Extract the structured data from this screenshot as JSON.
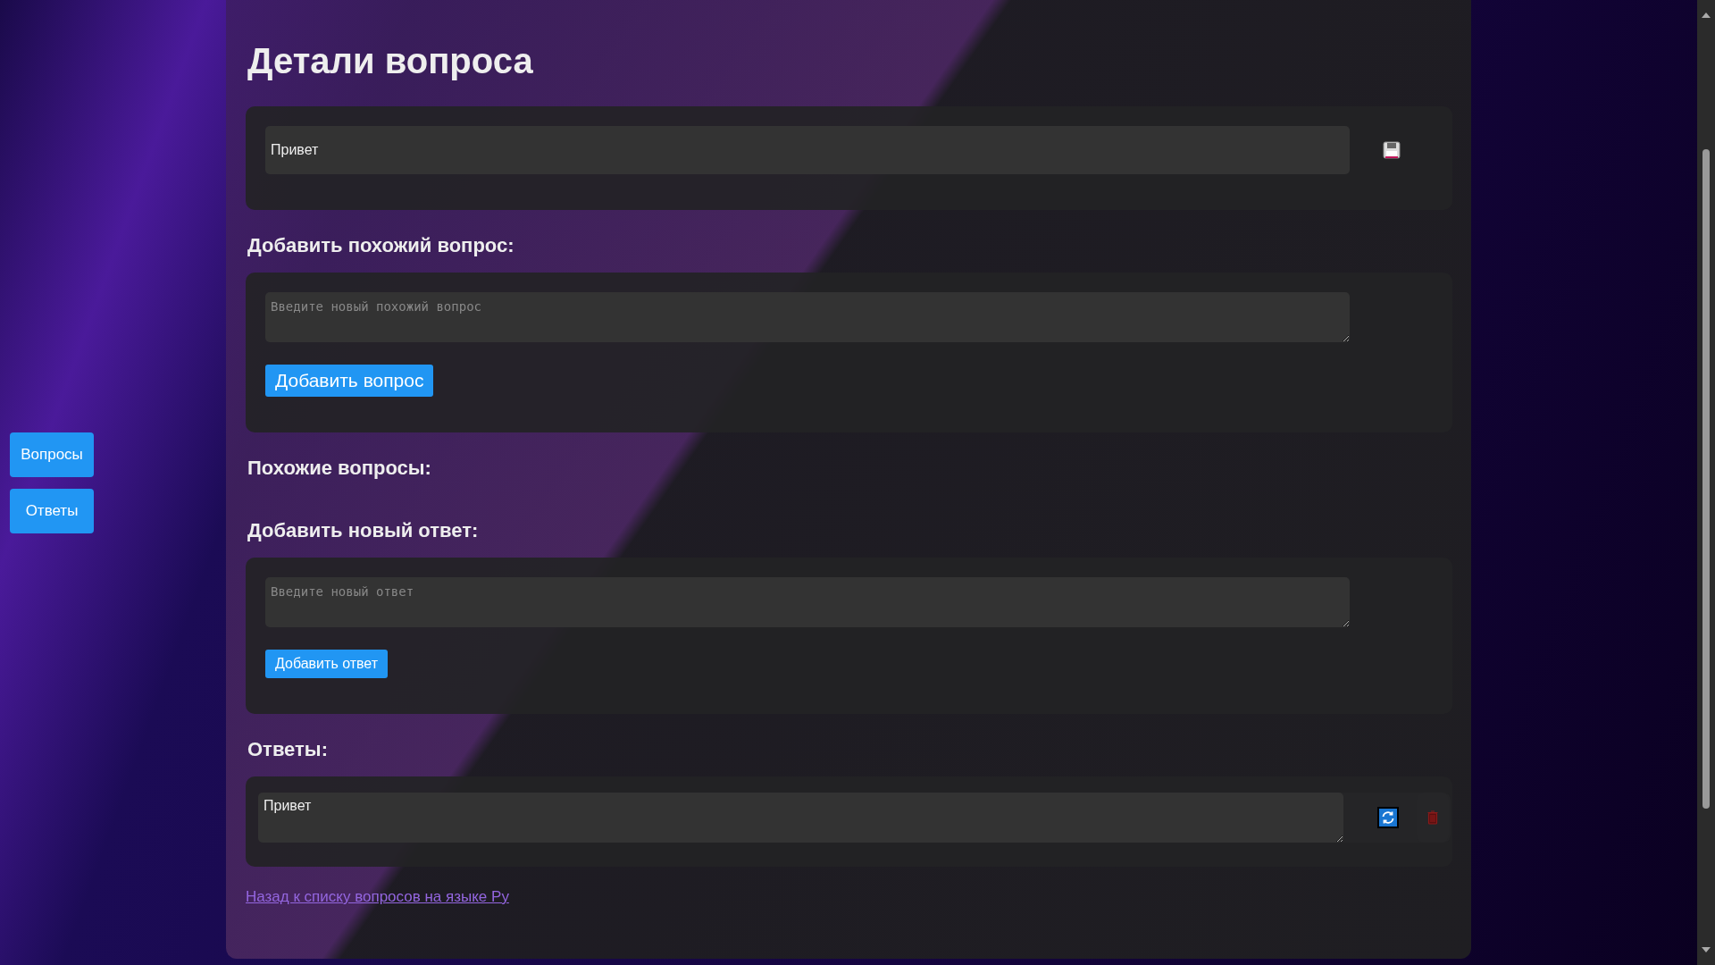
{
  "sidebar": {
    "items": [
      {
        "label": "Вопросы"
      },
      {
        "label": "Ответы"
      }
    ]
  },
  "title": "Детали вопроса",
  "question": {
    "value": "Привет"
  },
  "add_similar": {
    "heading": "Добавить похожий вопрос:",
    "placeholder": "Введите новый похожий вопрос",
    "button": "Добавить вопрос"
  },
  "similar_questions": {
    "heading": "Похожие вопросы:"
  },
  "add_answer": {
    "heading": "Добавить новый ответ:",
    "placeholder": "Введите новый ответ",
    "button": "Добавить ответ"
  },
  "answers": {
    "heading": "Ответы:",
    "items": [
      {
        "text": "Привет"
      }
    ]
  },
  "back_link": "Назад к списку вопросов на языке Ру"
}
